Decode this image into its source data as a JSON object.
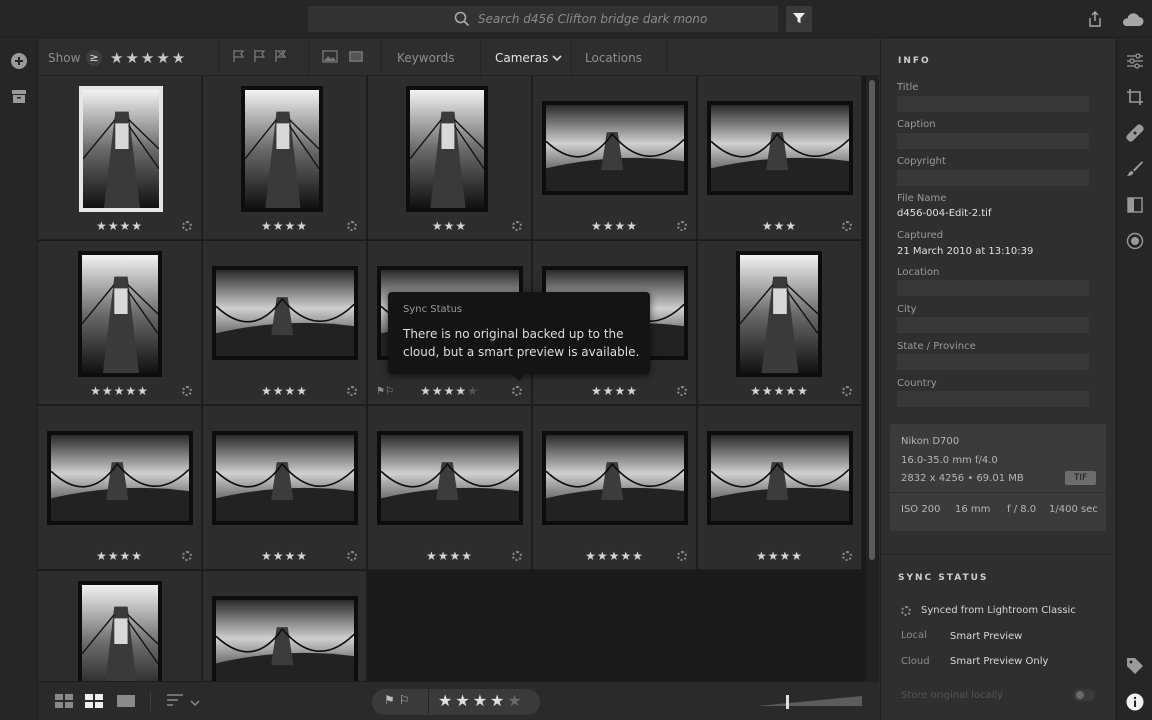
{
  "search": {
    "placeholder": "Search d456 Clifton bridge dark mono",
    "icon": "search-icon"
  },
  "filterbar": {
    "show_label": "Show",
    "rating_operator": "≥",
    "rating_stars": "★★★★★",
    "keywords_label": "Keywords",
    "cameras_label": "Cameras",
    "locations_label": "Locations"
  },
  "grid": {
    "rows": [
      [
        {
          "rating": 4,
          "selected": true
        },
        {
          "rating": 4
        },
        {
          "rating": 3
        },
        {
          "rating": 4
        },
        {
          "rating": 3
        }
      ],
      [
        {
          "rating": 5
        },
        {
          "rating": 4
        },
        {
          "rating": 4,
          "max": 5,
          "flags": "⚑⚐"
        },
        {
          "rating": 4
        },
        {
          "rating": 5
        }
      ],
      [
        {
          "rating": 4
        },
        {
          "rating": 4
        },
        {
          "rating": 4
        },
        {
          "rating": 5
        },
        {
          "rating": 4
        }
      ],
      [
        {
          "rating": 0
        },
        {
          "rating": 0
        }
      ]
    ]
  },
  "tooltip": {
    "title": "Sync Status",
    "body": "There is no original backed up to the cloud, but a smart preview is available."
  },
  "bottombar": {
    "flags": "⚑ ⚐",
    "stars_full": "★★★★",
    "stars_empty": "★"
  },
  "info": {
    "section_title": "INFO",
    "title_label": "Title",
    "caption_label": "Caption",
    "copyright_label": "Copyright",
    "filename_label": "File Name",
    "filename_value": "d456-004-Edit-2.tif",
    "captured_label": "Captured",
    "captured_value": "21 March 2010 at 13:10:39",
    "location_label": "Location",
    "city_label": "City",
    "state_label": "State / Province",
    "country_label": "Country"
  },
  "camera": {
    "model": "Nikon D700",
    "lens": "16.0-35.0 mm f/4.0",
    "dims": "2832 x 4256 • 69.01 MB",
    "format": "TIF",
    "iso": "ISO 200",
    "focal": "16 mm",
    "aperture": "f / 8.0",
    "shutter": "1/400 sec"
  },
  "sync": {
    "section_title": "SYNC STATUS",
    "status": "Synced from Lightroom Classic",
    "local_label": "Local",
    "local_value": "Smart Preview",
    "cloud_label": "Cloud",
    "cloud_value": "Smart Preview Only",
    "store_label": "Store original locally"
  },
  "colors": {
    "panel": "#2f2f2f",
    "grid_bg": "#1a1a1a",
    "accent": "#e6e6e6"
  }
}
